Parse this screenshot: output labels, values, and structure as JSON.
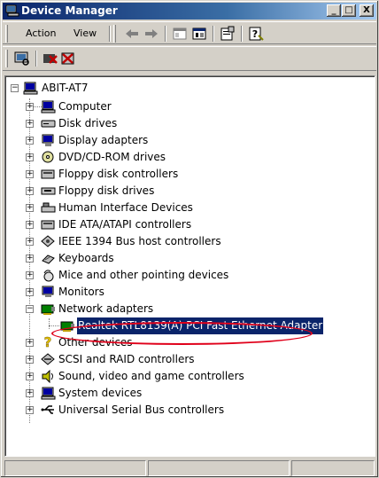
{
  "window": {
    "title": "Device Manager",
    "controls": {
      "minimize": "_",
      "maximize": "□",
      "close": "X"
    }
  },
  "menu": {
    "action_label": "Action",
    "view_label": "View"
  },
  "toolbar_icons": [
    "back-arrow-icon",
    "forward-arrow-icon",
    "show-hide-tree-icon",
    "view-icon",
    "properties-icon",
    "help-icon"
  ],
  "toolbar2_icons": [
    "scan-hardware-icon",
    "uninstall-icon",
    "disable-icon"
  ],
  "tree": {
    "root": "ABIT-AT7",
    "categories": [
      {
        "label": "Computer",
        "icon": "computer-icon"
      },
      {
        "label": "Disk drives",
        "icon": "disk-drive-icon"
      },
      {
        "label": "Display adapters",
        "icon": "display-adapter-icon"
      },
      {
        "label": "DVD/CD-ROM drives",
        "icon": "cdrom-icon"
      },
      {
        "label": "Floppy disk controllers",
        "icon": "floppy-controller-icon"
      },
      {
        "label": "Floppy disk drives",
        "icon": "floppy-drive-icon"
      },
      {
        "label": "Human Interface Devices",
        "icon": "hid-icon"
      },
      {
        "label": "IDE ATA/ATAPI controllers",
        "icon": "ide-controller-icon"
      },
      {
        "label": "IEEE 1394 Bus host controllers",
        "icon": "ieee1394-icon"
      },
      {
        "label": "Keyboards",
        "icon": "keyboard-icon"
      },
      {
        "label": "Mice and other pointing devices",
        "icon": "mouse-icon"
      },
      {
        "label": "Monitors",
        "icon": "monitor-icon"
      },
      {
        "label": "Network adapters",
        "icon": "network-adapter-icon",
        "expanded": true
      },
      {
        "label": "Other devices",
        "icon": "unknown-device-icon"
      },
      {
        "label": "SCSI and RAID controllers",
        "icon": "scsi-icon"
      },
      {
        "label": "Sound, video and game controllers",
        "icon": "sound-icon"
      },
      {
        "label": "System devices",
        "icon": "system-device-icon"
      },
      {
        "label": "Universal Serial Bus controllers",
        "icon": "usb-icon"
      }
    ],
    "network_child": "Realtek RTL8139(A) PCI Fast Ethernet Adapter"
  },
  "colors": {
    "selection": "#0a246a",
    "annotation_circle": "#e0001a"
  }
}
